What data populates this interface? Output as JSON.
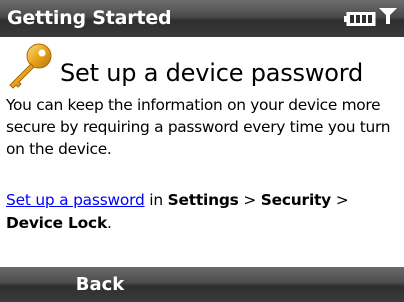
{
  "titlebar": {
    "title": "Getting Started",
    "status_icons": [
      "battery-icon",
      "signal-icon"
    ]
  },
  "content": {
    "icon": "key-icon",
    "heading": "Set up a device password",
    "description": "You can keep the information on your device more secure by requiring a password every time you turn on the device.",
    "link_text": "Set up a password",
    "in_text": " in ",
    "path_settings": "Settings",
    "sep1": " > ",
    "path_security": "Security",
    "sep2": " > ",
    "path_device_lock": "Device Lock",
    "end_period": "."
  },
  "softkeys": {
    "left_label": "Back"
  },
  "colors": {
    "link": "#0000ff",
    "titlebar": "#3a3a3a",
    "softbar": "#3b3b3b",
    "key_gold": "#e8a317"
  }
}
